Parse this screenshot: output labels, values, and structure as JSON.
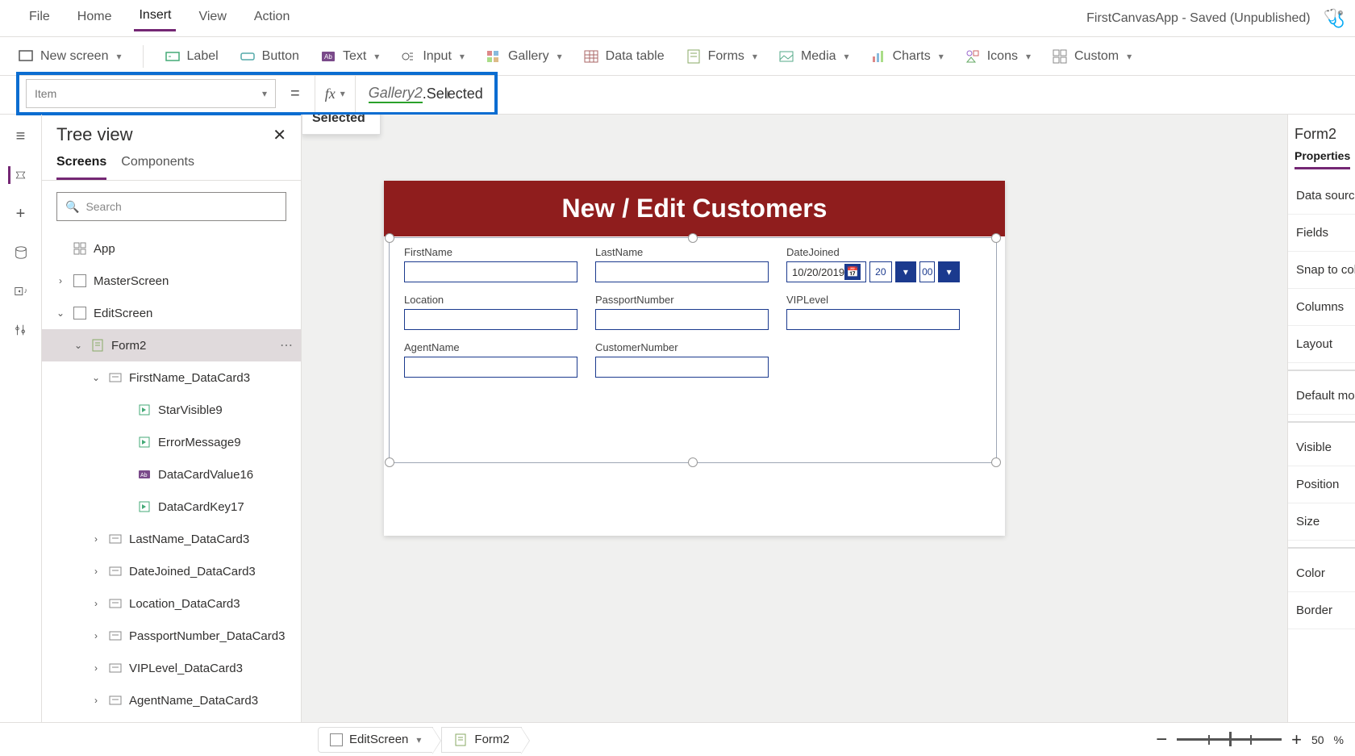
{
  "menu": {
    "items": [
      "File",
      "Home",
      "Insert",
      "View",
      "Action"
    ],
    "active": "Insert",
    "appStatus": "FirstCanvasApp - Saved (Unpublished)"
  },
  "ribbon": {
    "newScreen": "New screen",
    "label": "Label",
    "button": "Button",
    "text": "Text",
    "input": "Input",
    "gallery": "Gallery",
    "dataTable": "Data table",
    "forms": "Forms",
    "media": "Media",
    "charts": "Charts",
    "icons": "Icons",
    "custom": "Custom"
  },
  "formula": {
    "property": "Item",
    "token1": "Gallery2",
    "token2": ".Selected",
    "intellisense": "Selected"
  },
  "tree": {
    "title": "Tree view",
    "tabs": [
      "Screens",
      "Components"
    ],
    "activeTab": "Screens",
    "searchPlaceholder": "Search",
    "app": "App",
    "nodes": [
      {
        "level": 1,
        "caret": ">",
        "icon": "screen",
        "label": "MasterScreen"
      },
      {
        "level": 1,
        "caret": "v",
        "icon": "screen",
        "label": "EditScreen"
      },
      {
        "level": 2,
        "caret": "v",
        "icon": "form",
        "label": "Form2",
        "selected": true,
        "more": true
      },
      {
        "level": 3,
        "caret": "v",
        "icon": "card",
        "label": "FirstName_DataCard3"
      },
      {
        "level": 4,
        "caret": "",
        "icon": "ctl",
        "label": "StarVisible9"
      },
      {
        "level": 4,
        "caret": "",
        "icon": "ctl",
        "label": "ErrorMessage9"
      },
      {
        "level": 4,
        "caret": "",
        "icon": "txt",
        "label": "DataCardValue16"
      },
      {
        "level": 4,
        "caret": "",
        "icon": "ctl",
        "label": "DataCardKey17"
      },
      {
        "level": 3,
        "caret": ">",
        "icon": "card",
        "label": "LastName_DataCard3"
      },
      {
        "level": 3,
        "caret": ">",
        "icon": "card",
        "label": "DateJoined_DataCard3"
      },
      {
        "level": 3,
        "caret": ">",
        "icon": "card",
        "label": "Location_DataCard3"
      },
      {
        "level": 3,
        "caret": ">",
        "icon": "card",
        "label": "PassportNumber_DataCard3"
      },
      {
        "level": 3,
        "caret": ">",
        "icon": "card",
        "label": "VIPLevel_DataCard3"
      },
      {
        "level": 3,
        "caret": ">",
        "icon": "card",
        "label": "AgentName_DataCard3"
      }
    ]
  },
  "canvas": {
    "header": "New / Edit Customers",
    "fields": {
      "firstName": "FirstName",
      "lastName": "LastName",
      "dateJoined": "DateJoined",
      "dateValue": "10/20/2019",
      "hour": "20",
      "minute": "00",
      "location": "Location",
      "passport": "PassportNumber",
      "vip": "VIPLevel",
      "agent": "AgentName",
      "customerNum": "CustomerNumber"
    }
  },
  "props": {
    "title": "Form2",
    "tab": "Properties",
    "rows": [
      "Data source",
      "Fields",
      "Snap to colu",
      "Columns",
      "Layout",
      "",
      "Default mod",
      "",
      "Visible",
      "Position",
      "Size",
      "",
      "Color",
      "Border"
    ]
  },
  "footer": {
    "crumb1": "EditScreen",
    "crumb2": "Form2",
    "zoomValue": "50",
    "zoomUnit": "%"
  }
}
